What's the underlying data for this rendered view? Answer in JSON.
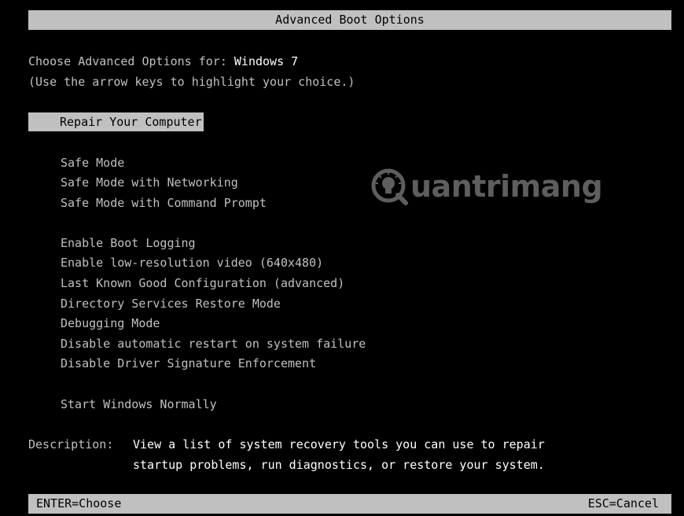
{
  "header": {
    "title": "Advanced Boot Options"
  },
  "intro": {
    "line1_prefix": "Choose Advanced Options for: ",
    "os_name": "Windows 7",
    "line2": "(Use the arrow keys to highlight your choice.)"
  },
  "menu": {
    "selected": "Repair Your Computer",
    "safe_mode": "Safe Mode",
    "safe_mode_networking": "Safe Mode with Networking",
    "safe_mode_command": "Safe Mode with Command Prompt",
    "boot_logging": "Enable Boot Logging",
    "low_res_video": "Enable low-resolution video (640x480)",
    "last_known_good": "Last Known Good Configuration (advanced)",
    "ds_restore": "Directory Services Restore Mode",
    "debugging": "Debugging Mode",
    "disable_restart": "Disable automatic restart on system failure",
    "disable_driver_sig": "Disable Driver Signature Enforcement",
    "start_normally": "Start Windows Normally"
  },
  "description": {
    "label": "Description:",
    "line1": "View a list of system recovery tools you can use to repair",
    "line2": "startup problems, run diagnostics, or restore your system."
  },
  "footer": {
    "left": "ENTER=Choose",
    "right": "ESC=Cancel"
  },
  "watermark": {
    "text": "uantrimang",
    "icon": "lightbulb-q-logo-icon"
  }
}
